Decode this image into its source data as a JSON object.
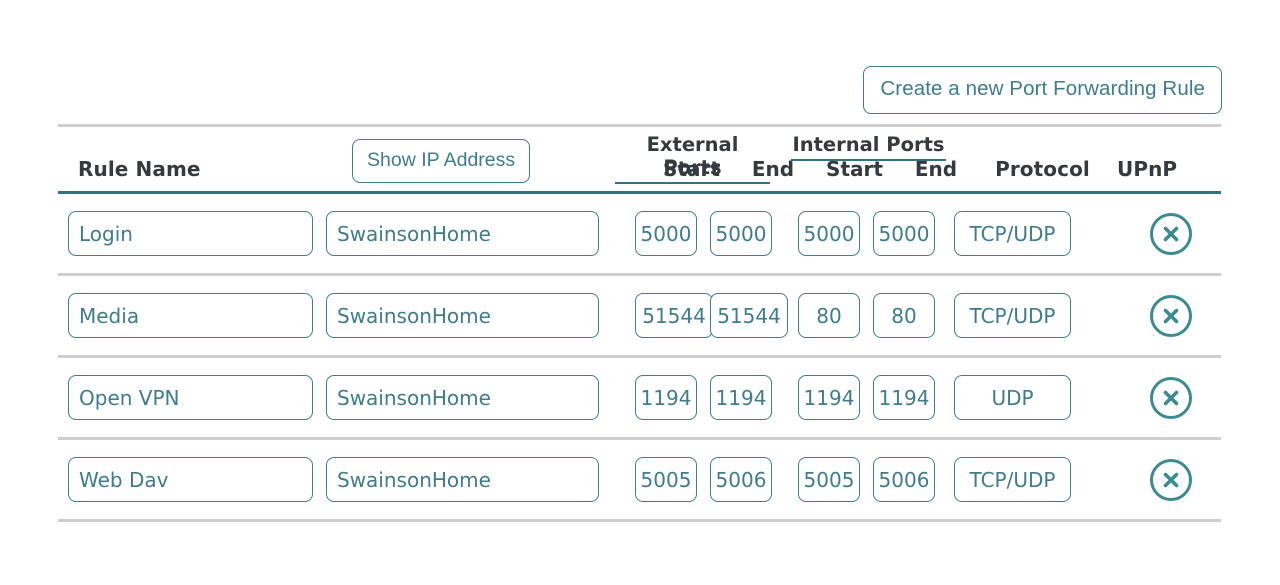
{
  "toolbar": {
    "create_rule_label": "Create a new Port Forwarding Rule"
  },
  "table": {
    "headers": {
      "rule_name": "Rule Name",
      "show_ip_address": "Show IP Address",
      "external_ports_group": "External Ports",
      "internal_ports_group": "Internal Ports",
      "external_start": "Start",
      "external_end": "End",
      "internal_start": "Start",
      "internal_end": "End",
      "protocol": "Protocol",
      "upnp": "UPnP"
    },
    "rows": [
      {
        "rule_name": "Login",
        "ip_address": "SwainsonHome",
        "external_start": "5000",
        "external_end": "5000",
        "internal_start": "5000",
        "internal_end": "5000",
        "protocol": "TCP/UDP",
        "delete_icon": "circle-x-icon"
      },
      {
        "rule_name": "Media",
        "ip_address": "SwainsonHome",
        "external_start": "51544",
        "external_end": "51544",
        "internal_start": "80",
        "internal_end": "80",
        "protocol": "TCP/UDP",
        "delete_icon": "circle-x-icon"
      },
      {
        "rule_name": "Open VPN",
        "ip_address": "SwainsonHome",
        "external_start": "1194",
        "external_end": "1194",
        "internal_start": "1194",
        "internal_end": "1194",
        "protocol": "UDP",
        "delete_icon": "circle-x-icon"
      },
      {
        "rule_name": "Web Dav",
        "ip_address": "SwainsonHome",
        "external_start": "5005",
        "external_end": "5006",
        "internal_start": "5005",
        "internal_end": "5006",
        "protocol": "TCP/UDP",
        "delete_icon": "circle-x-icon"
      }
    ]
  },
  "colors": {
    "accent_teal": "#3e7d8b",
    "header_rule_teal": "#35727f",
    "delete_icon_teal": "#3c8b92",
    "divider_gray": "#cecece",
    "header_text": "#343a40",
    "background": "#ffffff"
  }
}
